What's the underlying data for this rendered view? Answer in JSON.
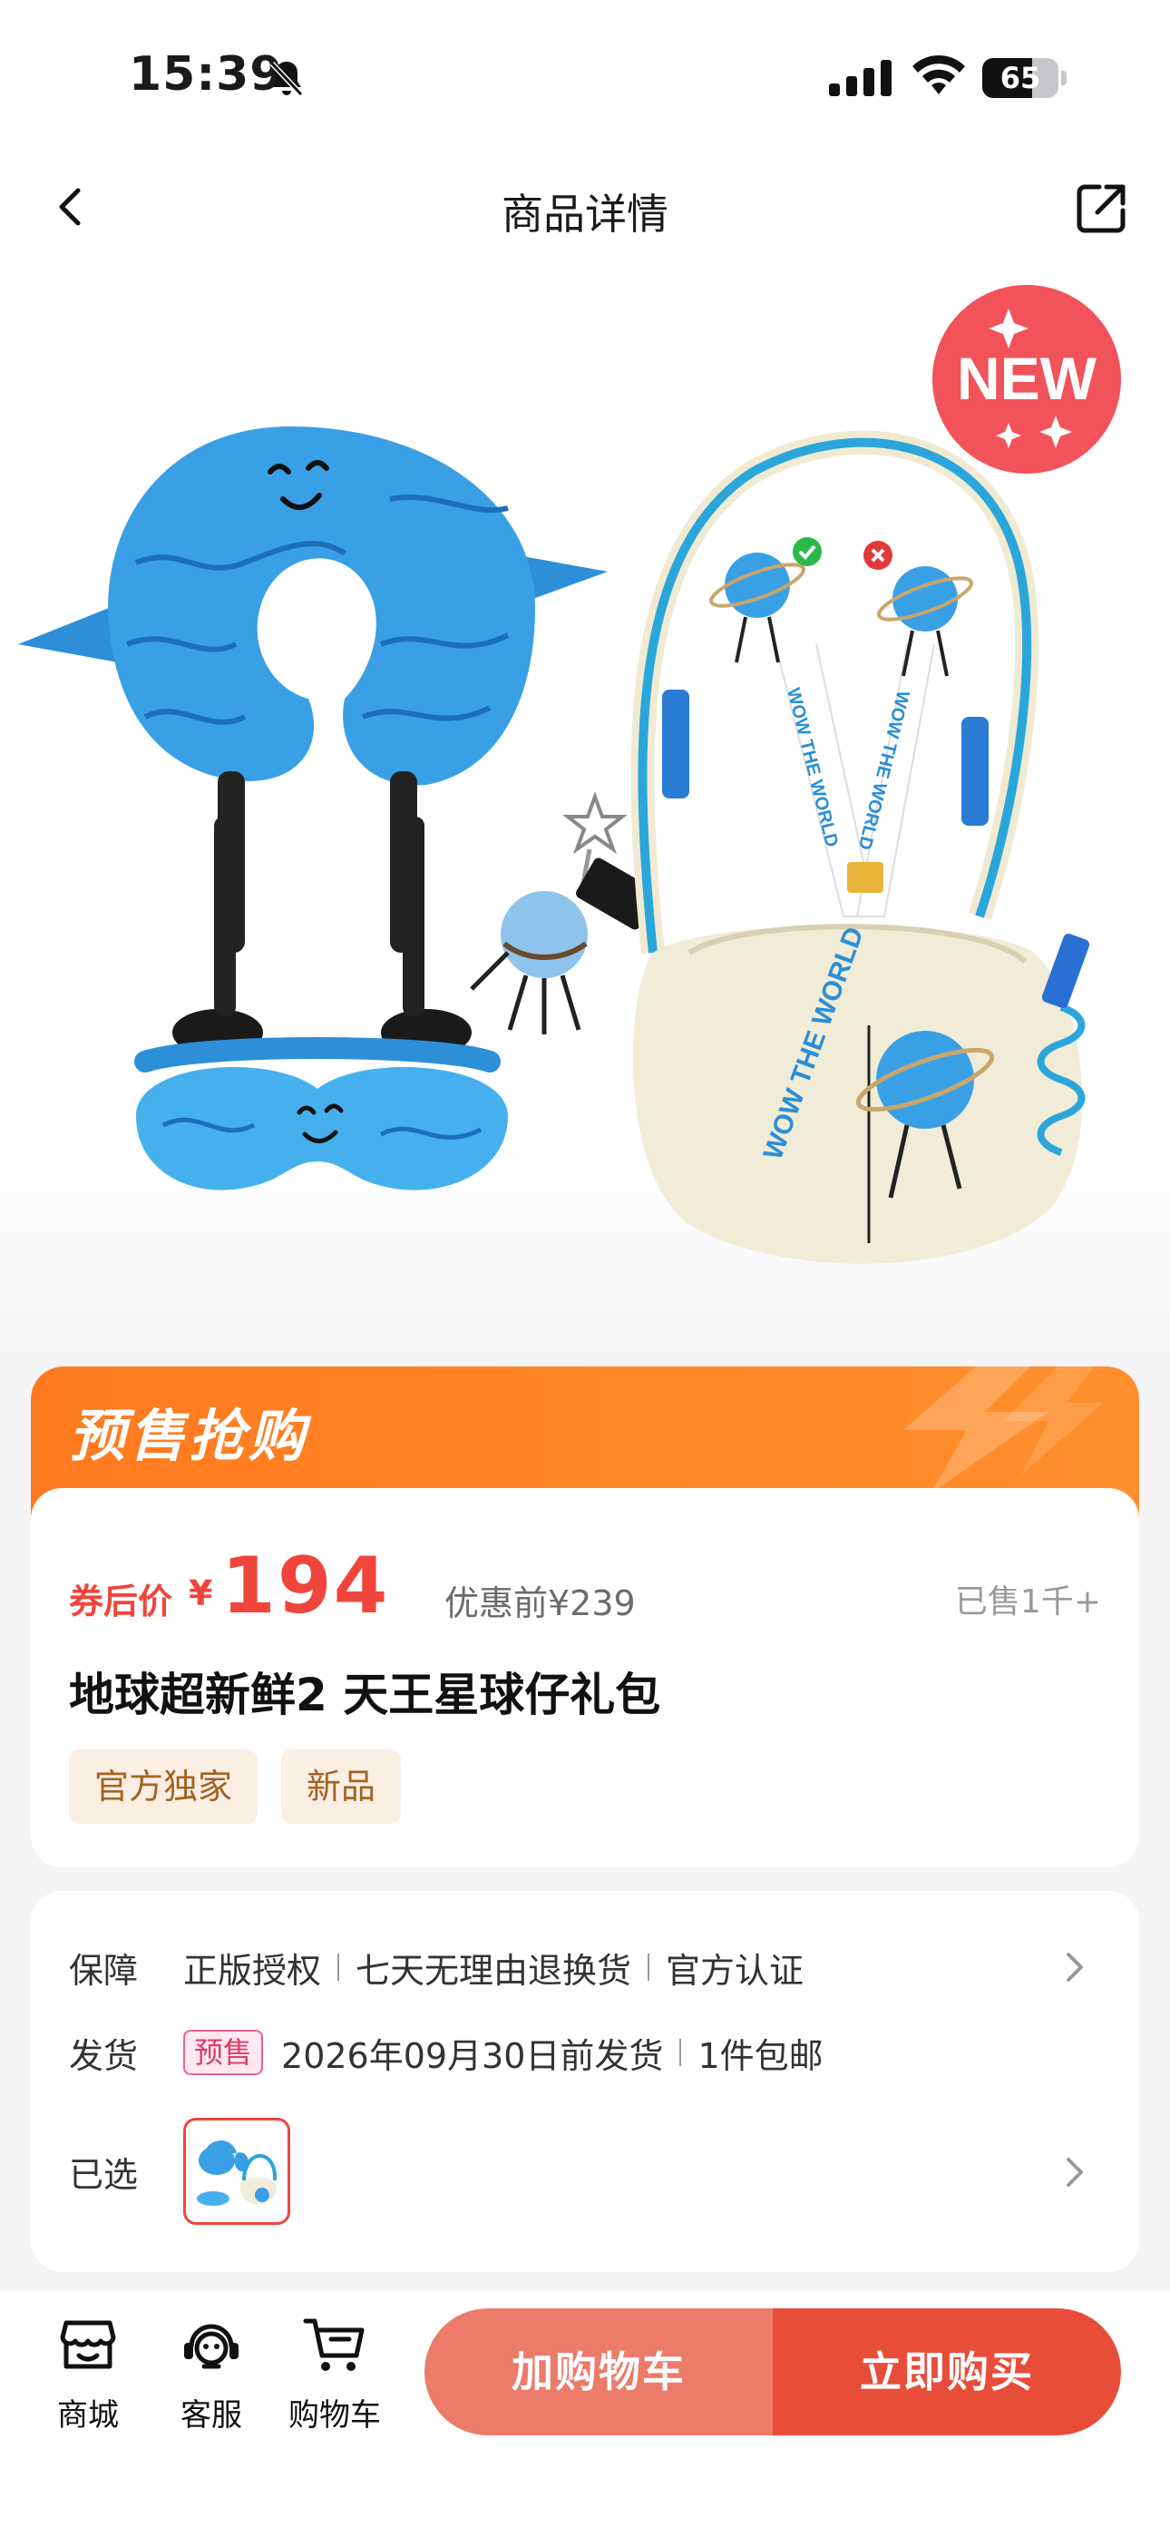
{
  "status_bar": {
    "time": "15:39",
    "battery": "65",
    "battery_level": 0.65
  },
  "nav": {
    "title": "商品详情"
  },
  "hero": {
    "new_badge": "NEW",
    "bag_text": "WOW THE WORLD",
    "lanyard_text_left": "WOW THE WORLD",
    "lanyard_text_right": "WOW THE WORLD"
  },
  "presale": {
    "title": "预售抢购"
  },
  "price": {
    "prefix": "券后价",
    "currency": "¥",
    "value": "194",
    "original": "优惠前¥239",
    "sold": "已售1千+"
  },
  "product": {
    "title": "地球超新鲜2 天王星球仔礼包",
    "tags": [
      "官方独家",
      "新品"
    ]
  },
  "info": {
    "guarantee": {
      "label": "保障",
      "items": [
        "正版授权",
        "七天无理由退换货",
        "官方认证"
      ]
    },
    "shipping": {
      "label": "发货",
      "badge": "预售",
      "date": "2026年09月30日前发货",
      "extra": "1件包邮"
    },
    "selected": {
      "label": "已选"
    }
  },
  "bottom_bar": {
    "mall": "商城",
    "service": "客服",
    "cart": "购物车",
    "add_to_cart": "加购物车",
    "buy_now": "立即购买"
  }
}
